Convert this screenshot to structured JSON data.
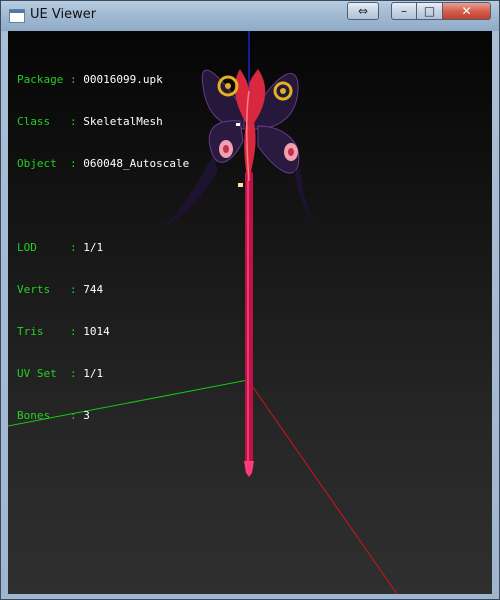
{
  "window": {
    "title": "UE Viewer"
  },
  "caption_buttons": {
    "switch": "⇔",
    "minimize": "–",
    "maximize": "□",
    "close": "✕"
  },
  "info": {
    "object_rows": [
      {
        "label": "Package",
        "sep": " : ",
        "value": "00016099.upk"
      },
      {
        "label": "Class  ",
        "sep": " : ",
        "value": "SkeletalMesh"
      },
      {
        "label": "Object ",
        "sep": " : ",
        "value": "060048_Autoscale"
      }
    ],
    "mesh_rows": [
      {
        "label": "LOD    ",
        "sep": " : ",
        "value": "1/1"
      },
      {
        "label": "Verts  ",
        "sep": " : ",
        "value": "744"
      },
      {
        "label": "Tris   ",
        "sep": " : ",
        "value": "1014"
      },
      {
        "label": "UV Set ",
        "sep": " : ",
        "value": "1/1"
      },
      {
        "label": "Bones  ",
        "sep": " : ",
        "value": "3"
      }
    ]
  },
  "colors": {
    "label_green": "#22d024",
    "axis_x": "#d0141e",
    "axis_y": "#14c814",
    "axis_z": "#1c2cff",
    "staff": "#e0145a",
    "wing_dark": "#25183a",
    "wing_red": "#d8283e",
    "accent_gold": "#e2b020"
  }
}
